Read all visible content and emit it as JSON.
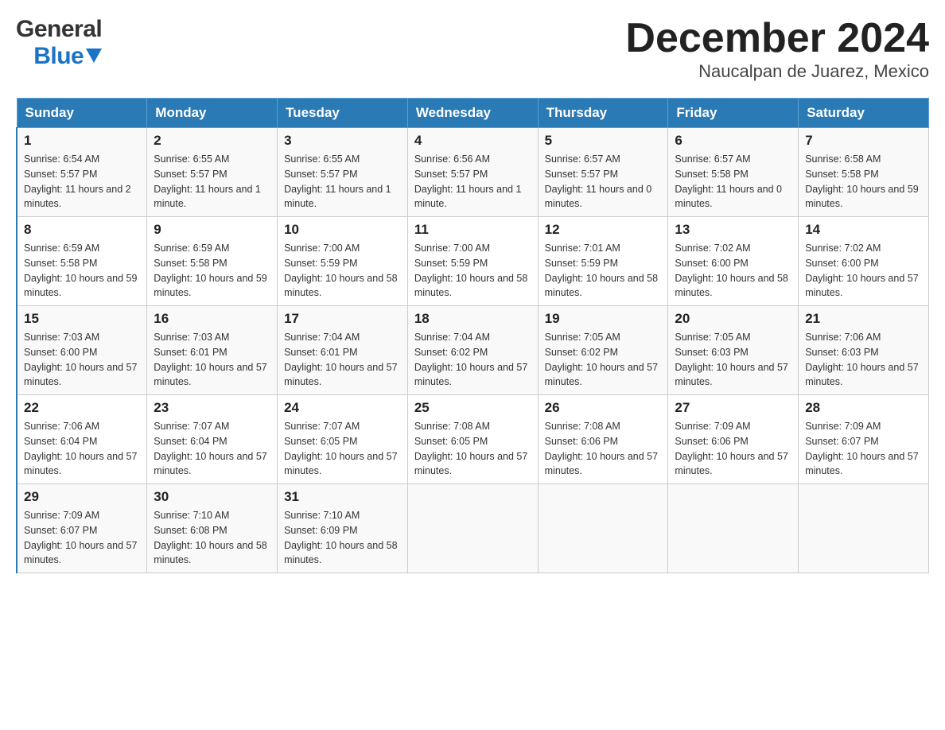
{
  "header": {
    "month_title": "December 2024",
    "location": "Naucalpan de Juarez, Mexico",
    "logo_general": "General",
    "logo_blue": "Blue"
  },
  "days_of_week": [
    "Sunday",
    "Monday",
    "Tuesday",
    "Wednesday",
    "Thursday",
    "Friday",
    "Saturday"
  ],
  "weeks": [
    [
      {
        "day": "1",
        "sunrise": "6:54 AM",
        "sunset": "5:57 PM",
        "daylight": "11 hours and 2 minutes."
      },
      {
        "day": "2",
        "sunrise": "6:55 AM",
        "sunset": "5:57 PM",
        "daylight": "11 hours and 1 minute."
      },
      {
        "day": "3",
        "sunrise": "6:55 AM",
        "sunset": "5:57 PM",
        "daylight": "11 hours and 1 minute."
      },
      {
        "day": "4",
        "sunrise": "6:56 AM",
        "sunset": "5:57 PM",
        "daylight": "11 hours and 1 minute."
      },
      {
        "day": "5",
        "sunrise": "6:57 AM",
        "sunset": "5:57 PM",
        "daylight": "11 hours and 0 minutes."
      },
      {
        "day": "6",
        "sunrise": "6:57 AM",
        "sunset": "5:58 PM",
        "daylight": "11 hours and 0 minutes."
      },
      {
        "day": "7",
        "sunrise": "6:58 AM",
        "sunset": "5:58 PM",
        "daylight": "10 hours and 59 minutes."
      }
    ],
    [
      {
        "day": "8",
        "sunrise": "6:59 AM",
        "sunset": "5:58 PM",
        "daylight": "10 hours and 59 minutes."
      },
      {
        "day": "9",
        "sunrise": "6:59 AM",
        "sunset": "5:58 PM",
        "daylight": "10 hours and 59 minutes."
      },
      {
        "day": "10",
        "sunrise": "7:00 AM",
        "sunset": "5:59 PM",
        "daylight": "10 hours and 58 minutes."
      },
      {
        "day": "11",
        "sunrise": "7:00 AM",
        "sunset": "5:59 PM",
        "daylight": "10 hours and 58 minutes."
      },
      {
        "day": "12",
        "sunrise": "7:01 AM",
        "sunset": "5:59 PM",
        "daylight": "10 hours and 58 minutes."
      },
      {
        "day": "13",
        "sunrise": "7:02 AM",
        "sunset": "6:00 PM",
        "daylight": "10 hours and 58 minutes."
      },
      {
        "day": "14",
        "sunrise": "7:02 AM",
        "sunset": "6:00 PM",
        "daylight": "10 hours and 57 minutes."
      }
    ],
    [
      {
        "day": "15",
        "sunrise": "7:03 AM",
        "sunset": "6:00 PM",
        "daylight": "10 hours and 57 minutes."
      },
      {
        "day": "16",
        "sunrise": "7:03 AM",
        "sunset": "6:01 PM",
        "daylight": "10 hours and 57 minutes."
      },
      {
        "day": "17",
        "sunrise": "7:04 AM",
        "sunset": "6:01 PM",
        "daylight": "10 hours and 57 minutes."
      },
      {
        "day": "18",
        "sunrise": "7:04 AM",
        "sunset": "6:02 PM",
        "daylight": "10 hours and 57 minutes."
      },
      {
        "day": "19",
        "sunrise": "7:05 AM",
        "sunset": "6:02 PM",
        "daylight": "10 hours and 57 minutes."
      },
      {
        "day": "20",
        "sunrise": "7:05 AM",
        "sunset": "6:03 PM",
        "daylight": "10 hours and 57 minutes."
      },
      {
        "day": "21",
        "sunrise": "7:06 AM",
        "sunset": "6:03 PM",
        "daylight": "10 hours and 57 minutes."
      }
    ],
    [
      {
        "day": "22",
        "sunrise": "7:06 AM",
        "sunset": "6:04 PM",
        "daylight": "10 hours and 57 minutes."
      },
      {
        "day": "23",
        "sunrise": "7:07 AM",
        "sunset": "6:04 PM",
        "daylight": "10 hours and 57 minutes."
      },
      {
        "day": "24",
        "sunrise": "7:07 AM",
        "sunset": "6:05 PM",
        "daylight": "10 hours and 57 minutes."
      },
      {
        "day": "25",
        "sunrise": "7:08 AM",
        "sunset": "6:05 PM",
        "daylight": "10 hours and 57 minutes."
      },
      {
        "day": "26",
        "sunrise": "7:08 AM",
        "sunset": "6:06 PM",
        "daylight": "10 hours and 57 minutes."
      },
      {
        "day": "27",
        "sunrise": "7:09 AM",
        "sunset": "6:06 PM",
        "daylight": "10 hours and 57 minutes."
      },
      {
        "day": "28",
        "sunrise": "7:09 AM",
        "sunset": "6:07 PM",
        "daylight": "10 hours and 57 minutes."
      }
    ],
    [
      {
        "day": "29",
        "sunrise": "7:09 AM",
        "sunset": "6:07 PM",
        "daylight": "10 hours and 57 minutes."
      },
      {
        "day": "30",
        "sunrise": "7:10 AM",
        "sunset": "6:08 PM",
        "daylight": "10 hours and 58 minutes."
      },
      {
        "day": "31",
        "sunrise": "7:10 AM",
        "sunset": "6:09 PM",
        "daylight": "10 hours and 58 minutes."
      },
      null,
      null,
      null,
      null
    ]
  ]
}
